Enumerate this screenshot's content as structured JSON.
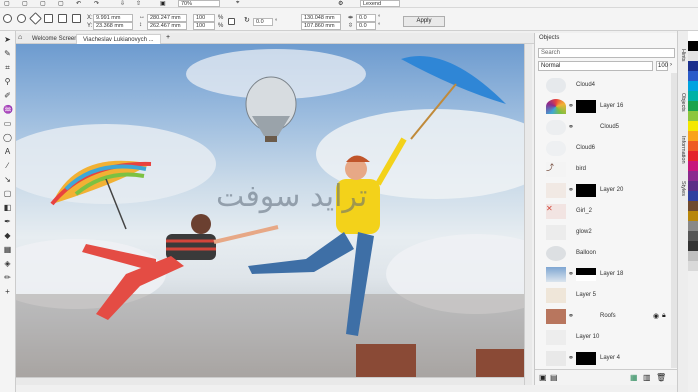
{
  "top_menu": {
    "zoom_value": "70%",
    "font_name": "Lexend"
  },
  "propbar": {
    "x_label": "X:",
    "x_value": "9.991 mm",
    "y_label": "Y:",
    "y_value": "23.368 mm",
    "w_value": "280.247 mm",
    "h_value": "262.467 mm",
    "scale_w": "100",
    "scale_h": "100",
    "pct": "%",
    "angle_value": "0.0",
    "pos2_w": "130.048 mm",
    "pos2_h": "107.860 mm",
    "rot_a": "0.0",
    "rot_b": "0.0",
    "deg": "°",
    "apply_label": "Apply"
  },
  "tabs": [
    {
      "label": "Welcome Screen"
    },
    {
      "label": "Viacheslav Lukianovych ..."
    }
  ],
  "watermark": "ترايد سوفت",
  "objects_panel": {
    "title": "Objects",
    "search_placeholder": "Search",
    "blend_mode": "Normal",
    "opacity": "100",
    "layers": [
      {
        "name": "Cloud4"
      },
      {
        "name": "Layer 16"
      },
      {
        "name": "Cloud5"
      },
      {
        "name": "Cloud6"
      },
      {
        "name": "bird"
      },
      {
        "name": "Layer 20"
      },
      {
        "name": "Girl_2"
      },
      {
        "name": "glow2"
      },
      {
        "name": "Balloon"
      },
      {
        "name": "Layer 18"
      },
      {
        "name": "Layer 5"
      },
      {
        "name": "Roofs"
      },
      {
        "name": "Layer 10"
      },
      {
        "name": "Layer 4"
      }
    ]
  },
  "side_tabs": [
    "Hints",
    "Objects",
    "Information",
    "Styles"
  ],
  "palette_colors": [
    "#ffffff",
    "#000000",
    "#e3e3e3",
    "#1a2f8c",
    "#2a5cc9",
    "#00a3e0",
    "#00b1a5",
    "#19a34b",
    "#8cc63e",
    "#f4e800",
    "#f9a31a",
    "#ee5b24",
    "#e4242b",
    "#c7167c",
    "#8b2a8e",
    "#5b2d86",
    "#303f9f",
    "#6f4a2e",
    "#b8860b",
    "#888888",
    "#555555",
    "#333333",
    "#bfbfbf",
    "#d9d9d9"
  ]
}
